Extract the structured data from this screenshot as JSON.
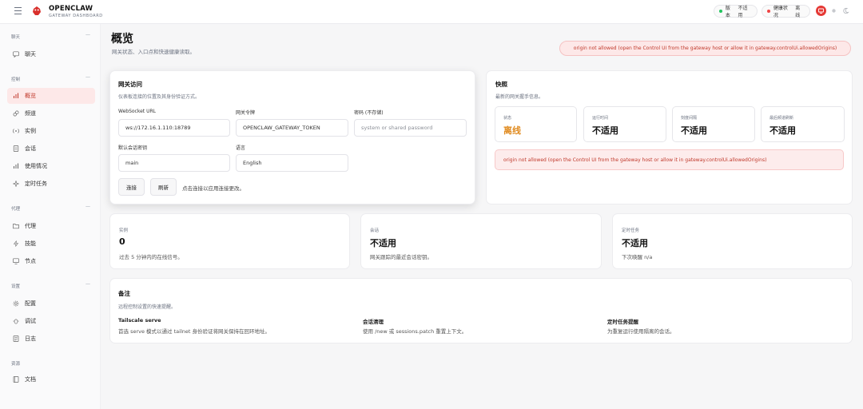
{
  "brand": {
    "title": "OPENCLAW",
    "subtitle": "GATEWAY DASHBOARD"
  },
  "topbar": {
    "version_label": "版本",
    "version_value": "不适用",
    "health_label": "健康状况",
    "health_value": "离线",
    "colors": {
      "version_dot": "#22c55e",
      "health_dot": "#ef4444",
      "accent": "#e53935"
    }
  },
  "sidebar": {
    "sections": [
      {
        "title": "聊天",
        "items": [
          {
            "label": "聊天",
            "icon": "chat-icon"
          }
        ]
      },
      {
        "title": "控制",
        "items": [
          {
            "label": "概览",
            "icon": "bar-chart-icon",
            "active": true
          },
          {
            "label": "频道",
            "icon": "link-icon"
          },
          {
            "label": "实例",
            "icon": "broadcast-icon"
          },
          {
            "label": "会话",
            "icon": "document-icon"
          },
          {
            "label": "使用情况",
            "icon": "bar-chart-icon"
          },
          {
            "label": "定时任务",
            "icon": "sparkle-icon"
          }
        ]
      },
      {
        "title": "代理",
        "items": [
          {
            "label": "代理",
            "icon": "folder-icon"
          },
          {
            "label": "技能",
            "icon": "bolt-icon"
          },
          {
            "label": "节点",
            "icon": "monitor-icon"
          }
        ]
      },
      {
        "title": "设置",
        "items": [
          {
            "label": "配置",
            "icon": "gear-icon"
          },
          {
            "label": "调试",
            "icon": "bug-icon"
          },
          {
            "label": "日志",
            "icon": "log-icon"
          }
        ]
      },
      {
        "title": "资源",
        "items": [
          {
            "label": "文档",
            "icon": "book-icon"
          }
        ]
      }
    ]
  },
  "page": {
    "title": "概览",
    "subtitle": "网关状态、入口点和快速健康读取。",
    "error_banner": "origin not allowed (open the Control UI from the gateway host or allow it in gateway.controlUi.allowedOrigins)"
  },
  "gateway": {
    "title": "网关访问",
    "subtitle": "仪表板连接的位置及其身份验证方式。",
    "ws_label": "WebSocket URL",
    "ws_value": "ws://172.16.1.110:18789",
    "token_label": "网关令牌",
    "token_value": "OPENCLAW_GATEWAY_TOKEN",
    "password_label": "密码 (不存储)",
    "password_placeholder": "system or shared password",
    "session_label": "默认会话密钥",
    "session_value": "main",
    "language_label": "语言",
    "language_value": "English",
    "connect_label": "连接",
    "refresh_label": "刷新",
    "hint": "点击连接以应用连接更改。"
  },
  "snapshot": {
    "title": "快照",
    "subtitle": "最新的网关握手信息。",
    "items": [
      {
        "label": "状态",
        "value": "离线"
      },
      {
        "label": "运行时间",
        "value": "不适用"
      },
      {
        "label": "刻度间隔",
        "value": "不适用"
      },
      {
        "label": "最后频道刷新",
        "value": "不适用"
      }
    ],
    "error": "origin not allowed (open the Control UI from the gateway host or allow it in gateway.controlUi.allowedOrigins)"
  },
  "stats": [
    {
      "label": "实例",
      "value": "0",
      "sub": "过去 5 分钟内的在线信号。"
    },
    {
      "label": "会话",
      "value": "不适用",
      "sub": "网关跟踪的最近会话密钥。"
    },
    {
      "label": "定时任务",
      "value": "不适用",
      "sub": "下次唤醒 n/a"
    }
  ],
  "notes": {
    "title": "备注",
    "subtitle": "远程控制设置的快速提醒。",
    "items": [
      {
        "heading": "Tailscale serve",
        "text": "首选 serve 模式以通过 tailnet 身份验证将网关保持在回环地址。"
      },
      {
        "heading": "会话清理",
        "text": "使用 /new 或 sessions.patch 重置上下文。"
      },
      {
        "heading": "定时任务提醒",
        "text": "为重复运行使用隔离的会话。"
      }
    ]
  }
}
